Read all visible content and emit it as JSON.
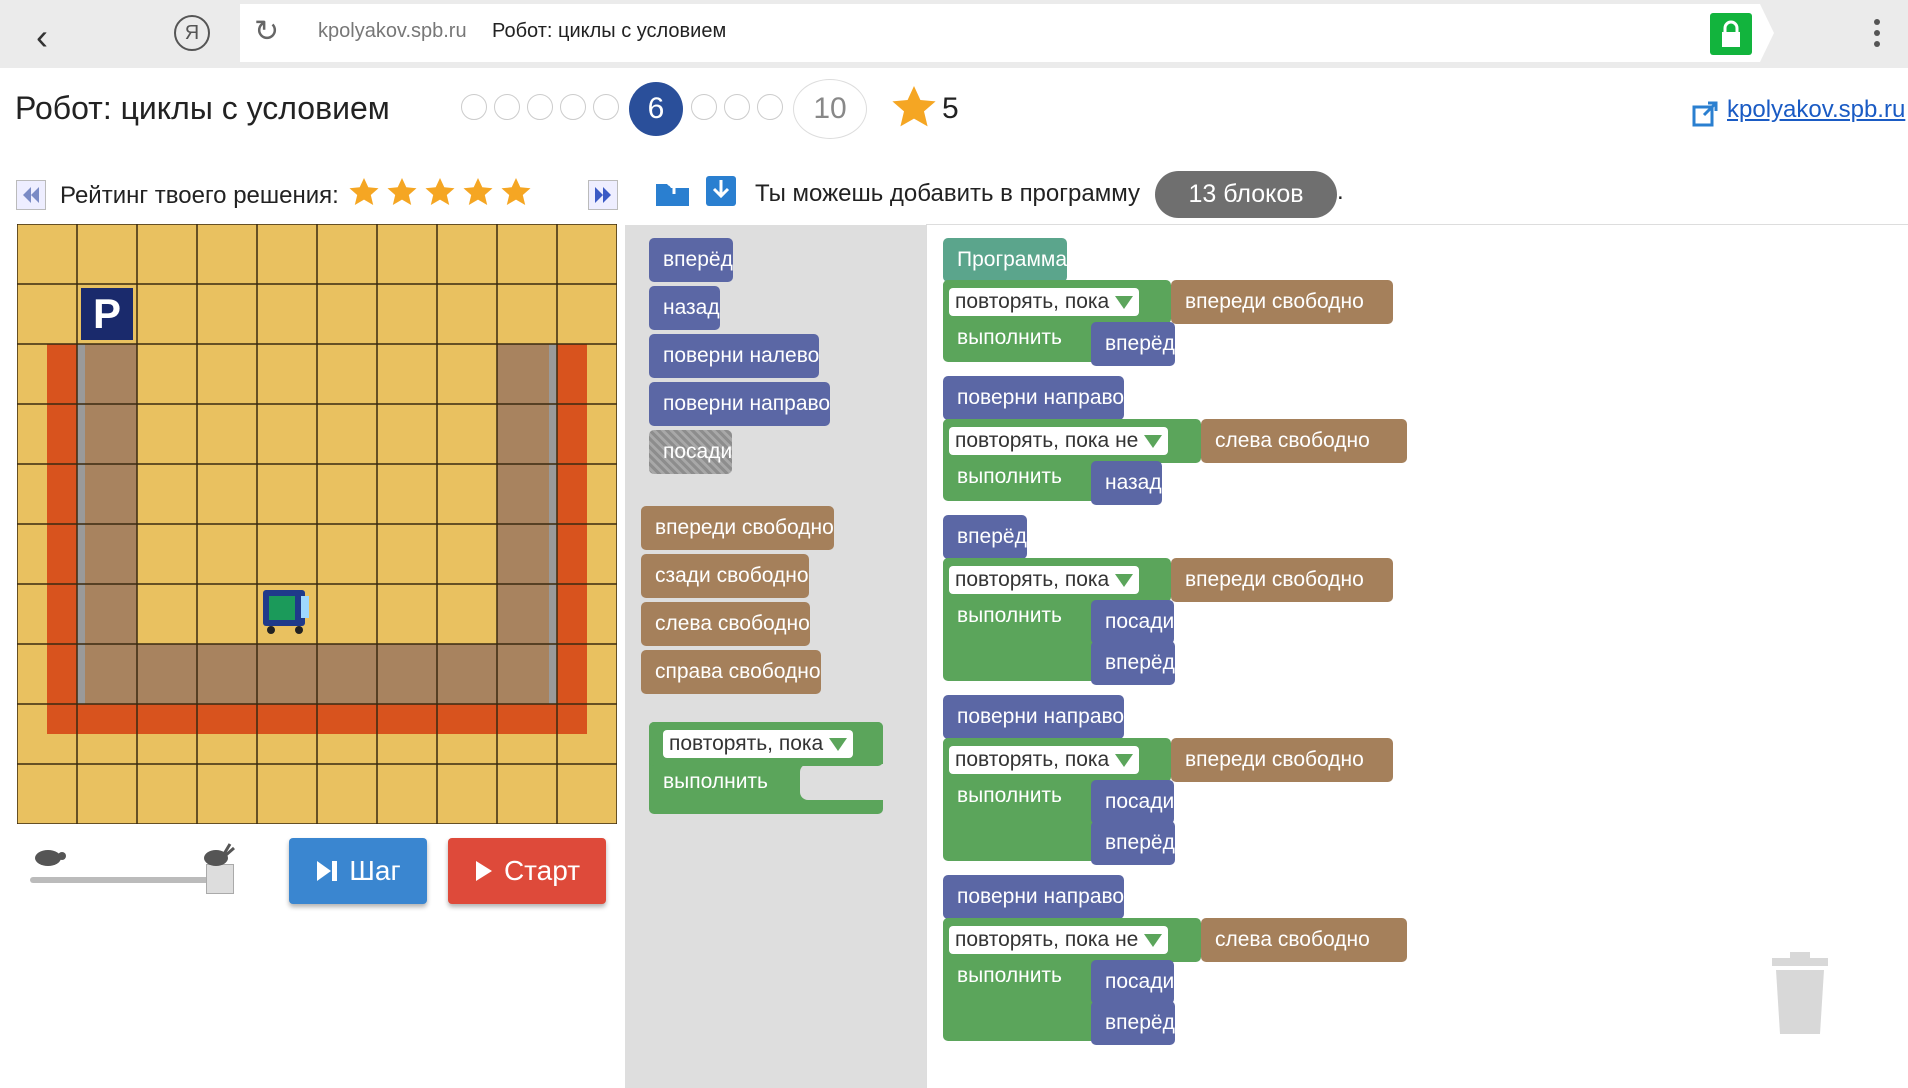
{
  "browser": {
    "host": "kpolyakov.spb.ru",
    "title": "Робот: циклы с условием",
    "yandex": "Я"
  },
  "header": {
    "title": "Робот: циклы с условием",
    "current_level": "6",
    "level_ten": "10",
    "stars": "5",
    "link": "kpolyakov.spb.ru"
  },
  "rating": {
    "label": "Рейтинг твоего решения:",
    "stars": 5
  },
  "info": {
    "prefix": "Ты можешь добавить в программу",
    "blocks": "13 блоков",
    "suffix": "."
  },
  "controls": {
    "step": "Шаг",
    "start": "Старт"
  },
  "toolbox": {
    "actions": [
      "вперёд",
      "назад",
      "поверни налево",
      "поверни направо",
      "посади"
    ],
    "conditions": [
      "впереди свободно",
      "сзади свободно",
      "слева свободно",
      "справа свободно"
    ],
    "loop_head": "повторять, пока",
    "loop_do": "выполнить"
  },
  "program": {
    "title": "Программа",
    "do": "выполнить",
    "lines": [
      {
        "kind": "loop",
        "head": "повторять, пока",
        "cond": "впереди свободно",
        "body": [
          "вперёд"
        ]
      },
      {
        "kind": "cmd",
        "text": "поверни направо"
      },
      {
        "kind": "loop",
        "head": "повторять, пока не",
        "cond": "слева свободно",
        "body": [
          "назад"
        ]
      },
      {
        "kind": "cmd",
        "text": "вперёд"
      },
      {
        "kind": "loop",
        "head": "повторять, пока",
        "cond": "впереди свободно",
        "body": [
          "посади",
          "вперёд"
        ]
      },
      {
        "kind": "cmd",
        "text": "поверни направо"
      },
      {
        "kind": "loop",
        "head": "повторять, пока",
        "cond": "впереди свободно",
        "body": [
          "посади",
          "вперёд"
        ]
      },
      {
        "kind": "cmd",
        "text": "поверни направо"
      },
      {
        "kind": "loop",
        "head": "повторять, пока не",
        "cond": "слева свободно",
        "body": [
          "посади",
          "вперёд"
        ]
      }
    ]
  },
  "grid": {
    "cols": 10,
    "rows": 10,
    "parking": "P"
  },
  "colors": {
    "accent": "#2a4f9a",
    "step": "#3a86d0",
    "start": "#de4a3a",
    "block_blue": "#5b67a5",
    "block_brown": "#a5805b",
    "block_green": "#5ba55b",
    "block_teal": "#5ba58c"
  }
}
